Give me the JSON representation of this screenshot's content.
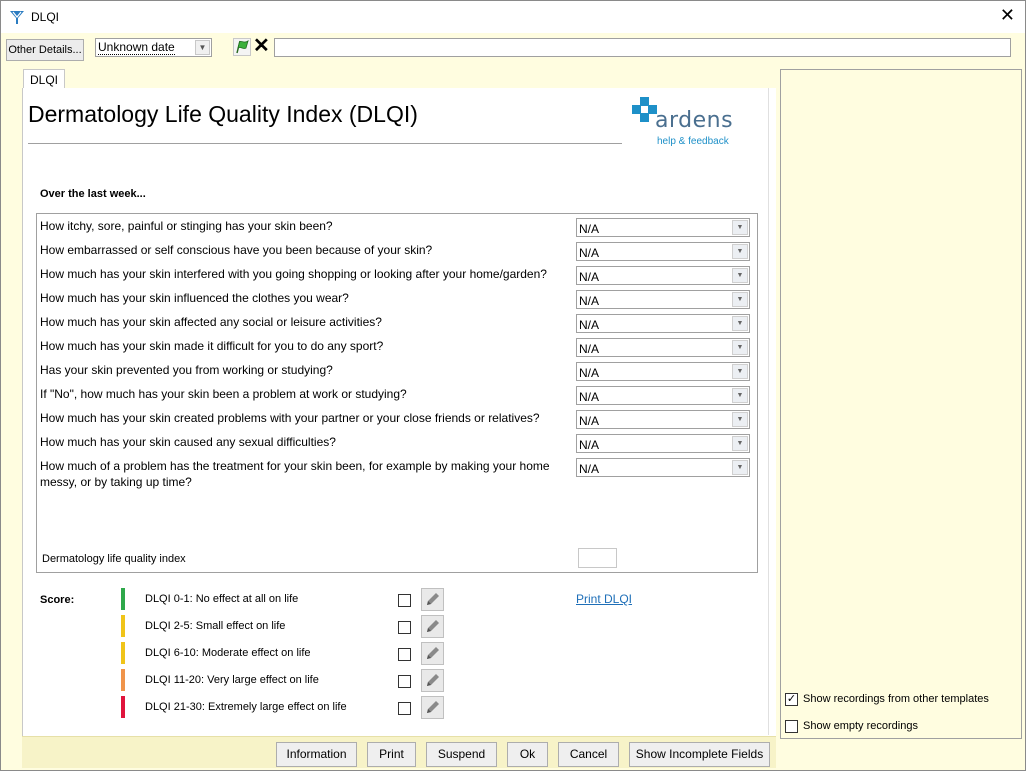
{
  "window": {
    "title": "DLQI"
  },
  "toolbar": {
    "other_details_label": "Other Details...",
    "date_value": "Unknown date"
  },
  "tab": {
    "label": "DLQI"
  },
  "form": {
    "heading": "Dermatology Life Quality Index (DLQI)",
    "logo": {
      "word": "ardens",
      "help_link": "help & feedback",
      "brand_color": "#1e90c8"
    },
    "over_label": "Over the last week...",
    "questions": [
      {
        "text": "How itchy, sore, painful or stinging has your skin been?",
        "value": "N/A"
      },
      {
        "text": "How embarrassed or self conscious have you been because of your skin?",
        "value": "N/A"
      },
      {
        "text": "How much has your skin interfered with you going shopping or looking after your home/garden?",
        "value": "N/A"
      },
      {
        "text": "How much has your skin influenced the clothes you wear?",
        "value": "N/A"
      },
      {
        "text": "How much has your skin affected any social or leisure activities?",
        "value": "N/A"
      },
      {
        "text": "How much has your skin made it difficult for you to do any sport?",
        "value": "N/A"
      },
      {
        "text": "Has your skin prevented you from working or studying?",
        "value": "N/A"
      },
      {
        "text": "If \"No\", how much has your skin been a problem at work or studying?",
        "value": "N/A"
      },
      {
        "text": "How much has your skin created problems with your partner or your close friends or relatives?",
        "value": "N/A"
      },
      {
        "text": "How much has your skin caused any sexual difficulties?",
        "value": "N/A"
      },
      {
        "text": "How much of a problem has the treatment for your skin been, for example by making your home messy, or by taking up time?",
        "value": "N/A"
      }
    ],
    "index_label": "Dermatology life quality index",
    "index_value": ""
  },
  "score": {
    "label": "Score:",
    "print_link": "Print DLQI",
    "bands": [
      {
        "text": "DLQI 0-1: No effect at all on life",
        "color": "#2ea84a"
      },
      {
        "text": "DLQI 2-5: Small effect on life",
        "color": "#f0c419"
      },
      {
        "text": "DLQI 6-10: Moderate effect on life",
        "color": "#f0c419"
      },
      {
        "text": "DLQI 11-20: Very large effect on life",
        "color": "#f0944a"
      },
      {
        "text": "DLQI 21-30: Extremely large effect on life",
        "color": "#e0143c"
      }
    ]
  },
  "buttons": {
    "information": "Information",
    "print": "Print",
    "suspend": "Suspend",
    "ok": "Ok",
    "cancel": "Cancel",
    "show_incomplete": "Show Incomplete Fields"
  },
  "right_panel": {
    "show_other_templates": {
      "label": "Show recordings from other templates",
      "checked": true
    },
    "show_empty": {
      "label": "Show empty recordings",
      "checked": false
    }
  }
}
